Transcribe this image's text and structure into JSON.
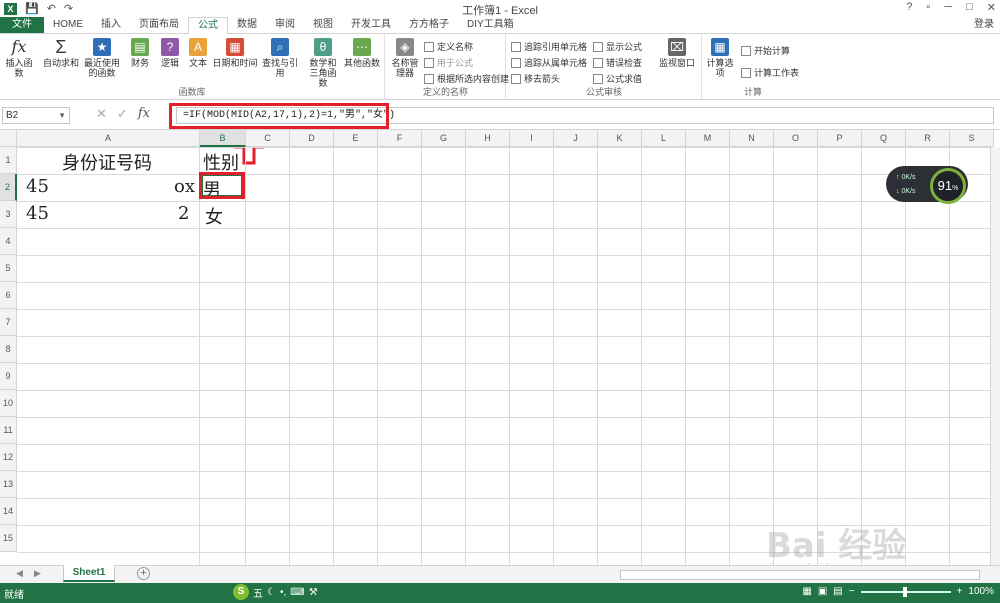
{
  "window": {
    "title": "工作簿1 - Excel",
    "help": "?",
    "restore": "▫",
    "minimize": "─",
    "maximize": "□",
    "close": "✕",
    "signin": "登录"
  },
  "quick_access": {
    "save": "💾",
    "undo": "↶",
    "redo": "↷"
  },
  "tabs": [
    "文件",
    "HOME",
    "插入",
    "页面布局",
    "公式",
    "数据",
    "审阅",
    "视图",
    "开发工具",
    "方方格子",
    "DIY工具箱"
  ],
  "active_tab": "公式",
  "ribbon": {
    "groups": [
      "函数库",
      "定义的名称",
      "公式审核",
      "计算"
    ],
    "buttons": {
      "insert_function": "插入函数",
      "autosum": "自动求和",
      "recent": "最近使用的函数",
      "financial": "财务",
      "logical": "逻辑",
      "text": "文本",
      "datetime": "日期和时间",
      "lookup": "查找与引用",
      "math": "数学和三角函数",
      "more": "其他函数",
      "name_manager": "名称管理器",
      "define_name": "定义名称",
      "use_in_formula": "用于公式",
      "create_from_selection": "根据所选内容创建",
      "trace_precedents": "追踪引用单元格",
      "trace_dependents": "追踪从属单元格",
      "remove_arrows": "移去箭头",
      "show_formulas": "显示公式",
      "error_checking": "错误检查",
      "evaluate": "公式求值",
      "watch": "监视窗口",
      "calc_options": "计算选项",
      "calc_now": "开始计算",
      "calc_sheet": "计算工作表"
    }
  },
  "formula_bar": {
    "name_box": "B2",
    "fx": "fx",
    "formula": "=IF(MOD(MID(A2,17,1),2)=1,\"男\",\"女\")"
  },
  "columns": [
    "A",
    "B",
    "C",
    "D",
    "E",
    "F",
    "G",
    "H",
    "I",
    "J",
    "K",
    "L",
    "M",
    "N",
    "O",
    "P",
    "Q",
    "R",
    "S"
  ],
  "rows": [
    "1",
    "2",
    "3",
    "4",
    "5",
    "6",
    "7",
    "8",
    "9",
    "10",
    "11",
    "12",
    "13",
    "14",
    "15"
  ],
  "cells": {
    "A1": "身份证号码",
    "B1": "性别",
    "A2_start": "45",
    "A2_end": "ox",
    "A3_start": "45",
    "A3_end": "2",
    "B2": "男",
    "B3": "女"
  },
  "net_widget": {
    "up": "0K/s",
    "down": "0K/s",
    "percent": "91",
    "unit": "%"
  },
  "sheet": {
    "name": "Sheet1",
    "add": "+"
  },
  "status": {
    "ready": "就绪",
    "zoom": "100%",
    "ime": "五"
  },
  "watermark": {
    "main": "Bai 经验",
    "url": "jingyan.baidu.com"
  },
  "colors": {
    "excel_green": "#217346",
    "highlight_red": "#e0202a"
  }
}
